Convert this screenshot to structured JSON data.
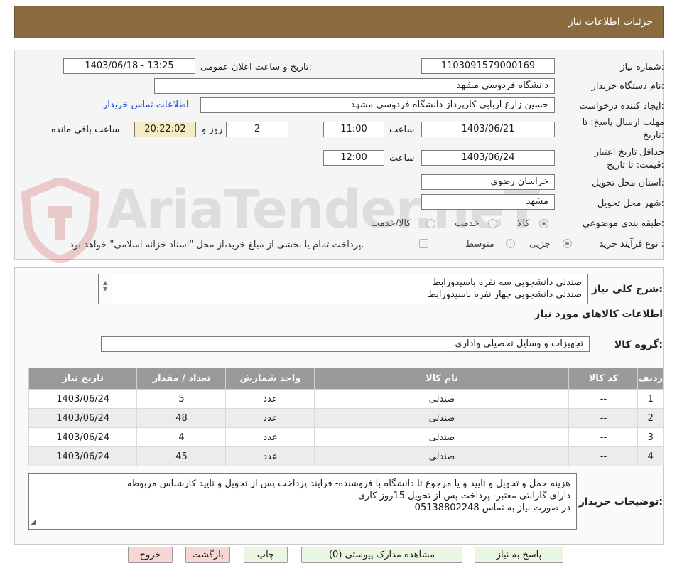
{
  "header": {
    "title": "جزئیات اطلاعات نیاز"
  },
  "form": {
    "need_number_label": "شماره نیاز:",
    "need_number": "1103091579000169",
    "announce_label": "تاریخ و ساعت اعلان عمومی:",
    "announce_value": "1403/06/18 - 13:25",
    "buyer_org_label": "نام دستگاه خریدار:",
    "buyer_org": "دانشگاه فردوسی مشهد",
    "creator_label": "ایجاد کننده درخواست:",
    "creator": "حسین زارع اربابی کارپرداز دانشگاه فردوسی مشهد",
    "contact_link": "اطلاعات تماس خریدار",
    "deadline_label_1": "مهلت ارسال پاسخ: تا",
    "deadline_label_2": "تاریخ:",
    "deadline_date": "1403/06/21",
    "time_label": "ساعت",
    "deadline_time": "11:00",
    "days_value": "2",
    "days_label": "روز و",
    "remaining_time": "20:22:02",
    "remaining_label": "ساعت باقی مانده",
    "validity_label_1": "حداقل تاریخ اعتبار",
    "validity_label_2": "قیمت: تا تاریخ:",
    "validity_date": "1403/06/24",
    "validity_time": "12:00",
    "province_label": "استان محل تحویل:",
    "province": "خراسان رضوی",
    "city_label": "شهر محل تحویل:",
    "city": "مشهد",
    "category_label": "طبقه بندی موضوعی:",
    "category_options": [
      "کالا",
      "خدمت",
      "کالا/خدمت"
    ],
    "process_label": "نوع فرآیند خرید :",
    "process_options": [
      "جزیی",
      "متوسط"
    ],
    "treasury_note": "پرداخت تمام یا بخشی از مبلغ خرید،از محل \"اسناد خزانه اسلامی\" خواهد بود."
  },
  "watermark": {
    "text": "AriaTender.neT"
  },
  "summary": {
    "label": "شرح کلی نیاز:",
    "lines": [
      "صندلی دانشجویی سه نفره باسیدورابط",
      "صندلی دانشجویی چهار نفره باسیدورابط"
    ],
    "items_title": "اطلاعات کالاهای مورد نیاز",
    "group_label": "گروه کالا:",
    "group_value": "تجهیزات و وسایل تحصیلی واداری"
  },
  "table": {
    "headers": [
      "ردیف",
      "کد کالا",
      "نام کالا",
      "واحد شمارش",
      "تعداد / مقدار",
      "تاریخ نیاز"
    ],
    "rows": [
      [
        "1",
        "--",
        "صندلی",
        "عدد",
        "5",
        "1403/06/24"
      ],
      [
        "2",
        "--",
        "صندلی",
        "عدد",
        "48",
        "1403/06/24"
      ],
      [
        "3",
        "--",
        "صندلی",
        "عدد",
        "4",
        "1403/06/24"
      ],
      [
        "4",
        "--",
        "صندلی",
        "عدد",
        "45",
        "1403/06/24"
      ]
    ]
  },
  "notes": {
    "label": "توضیحات خریدار:",
    "lines": [
      "هزینه حمل و تحویل و تایید و یا مرجوع تا دانشگاه با فروشنده- فرایند پرداخت پس از تحویل و تایید کارشناس مربوطه",
      "دارای گارانتی معتبر- پرداخت پس از تحویل 15روز کاری",
      "در صورت نیاز به تماس 05138802248"
    ]
  },
  "buttons": {
    "reply": "پاسخ به نیاز",
    "attachments": "مشاهده مدارک پیوستی (0)",
    "print": "چاپ",
    "back": "بازگشت",
    "exit": "خروج"
  }
}
